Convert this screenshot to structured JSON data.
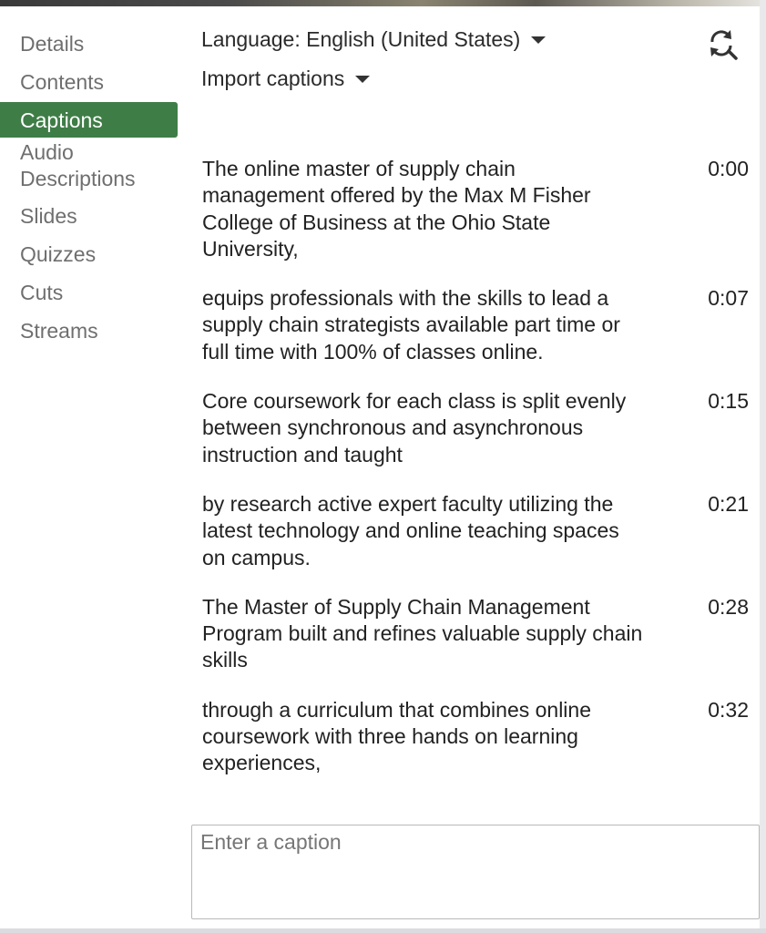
{
  "sidebar": {
    "items": [
      {
        "label": "Details",
        "active": false
      },
      {
        "label": "Contents",
        "active": false
      },
      {
        "label": "Captions",
        "active": true
      },
      {
        "label": "Audio Descriptions",
        "active": false
      },
      {
        "label": "Slides",
        "active": false
      },
      {
        "label": "Quizzes",
        "active": false
      },
      {
        "label": "Cuts",
        "active": false
      },
      {
        "label": "Streams",
        "active": false
      }
    ]
  },
  "header": {
    "language_label": "Language: English (United States)",
    "import_label": "Import captions",
    "refresh_icon": "refresh-search-icon"
  },
  "captions": [
    {
      "text": "The online master of supply chain management offered by the Max M Fisher College of Business at the Ohio State University,",
      "time": "0:00"
    },
    {
      "text": "equips professionals with the skills to lead a supply chain strategists available part time or full time with 100% of classes online.",
      "time": "0:07"
    },
    {
      "text": "Core coursework for each class is split evenly between synchronous and asynchronous instruction and taught",
      "time": "0:15"
    },
    {
      "text": "by research active expert faculty utilizing the latest technology and online teaching spaces on campus.",
      "time": "0:21"
    },
    {
      "text": "The Master of Supply Chain Management Program built and refines valuable supply chain skills",
      "time": "0:28"
    },
    {
      "text": "through a curriculum that combines online coursework with three hands on learning experiences,",
      "time": "0:32"
    }
  ],
  "input": {
    "placeholder": "Enter a caption",
    "value": ""
  },
  "colors": {
    "active_nav_bg": "#3f7d47",
    "nav_text": "#6f6f6f"
  }
}
